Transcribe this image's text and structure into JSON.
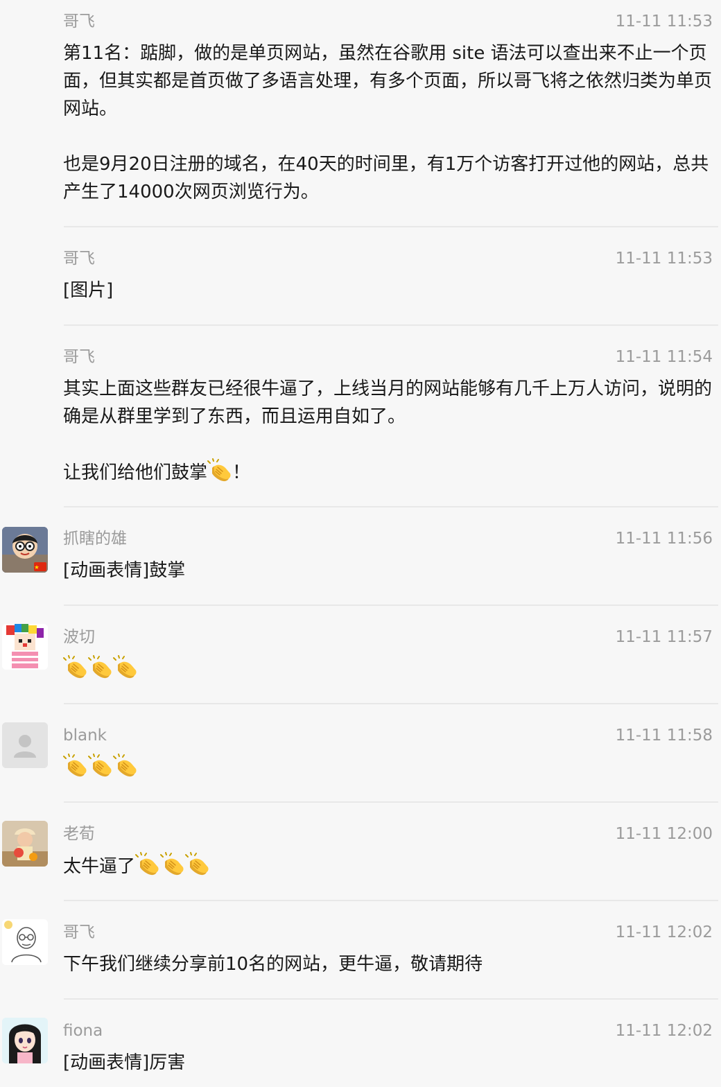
{
  "messages": [
    {
      "sender": "哥飞",
      "time": "11-11 11:53",
      "paragraphs": [
        "第11名：踮脚，做的是单页网站，虽然在谷歌用 site 语法可以查出来不止一个页面，但其实都是首页做了多语言处理，有多个页面，所以哥飞将之依然归类为单页网站。",
        "也是9月20日注册的域名，在40天的时间里，有1万个访客打开过他的网站，总共产生了14000次网页浏览行为。"
      ]
    },
    {
      "sender": "哥飞",
      "time": "11-11 11:53",
      "text": "[图片]"
    },
    {
      "sender": "哥飞",
      "time": "11-11 11:54",
      "paragraphs": [
        "其实上面这些群友已经很牛逼了，上线当月的网站能够有几千上万人访问，说明的确是从群里学到了东西，而且运用自如了。"
      ],
      "cheer_prefix": "让我们给他们鼓掌",
      "cheer_suffix": "！"
    },
    {
      "sender": "抓瞎的雄",
      "time": "11-11 11:56",
      "text": "[动画表情]鼓掌",
      "avatar": "cartoon-boy-avatar",
      "flag": "china-flag-icon"
    },
    {
      "sender": "波切",
      "time": "11-11 11:57",
      "clap_count": 3,
      "avatar": "pixel-clown-avatar"
    },
    {
      "sender": "blank",
      "time": "11-11 11:58",
      "clap_count": 3,
      "avatar": "default-user-avatar"
    },
    {
      "sender": "老荀",
      "time": "11-11 12:00",
      "text": "太牛逼了",
      "clap_count": 3,
      "avatar": "child-photo-avatar"
    },
    {
      "sender": "哥飞",
      "time": "11-11 12:02",
      "text": "下午我们继续分享前10名的网站，更牛逼，敬请期待",
      "avatar": "sketch-man-avatar"
    },
    {
      "sender": "fiona",
      "time": "11-11 12:02",
      "text": "[动画表情]厉害",
      "avatar": "anime-girl-avatar"
    }
  ]
}
